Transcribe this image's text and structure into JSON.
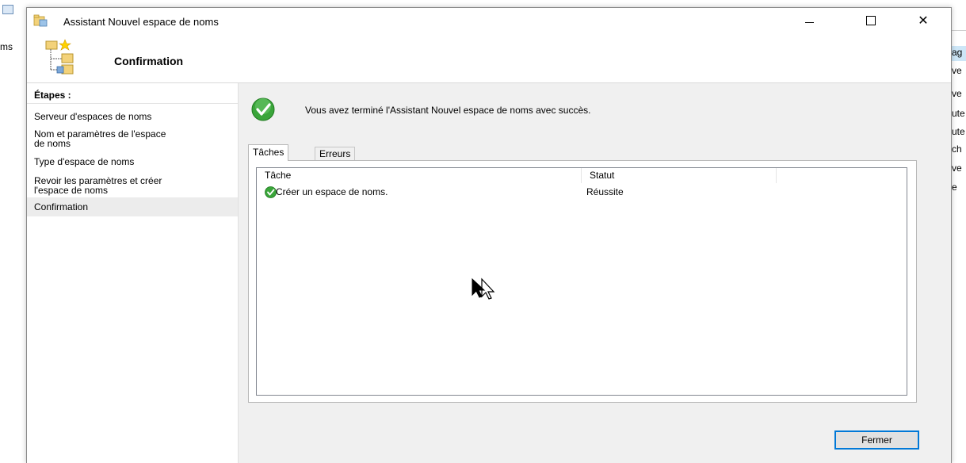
{
  "background_app": {
    "left_fragment": "ms",
    "right_fragments": [
      "ag",
      "ve",
      "ve",
      "ute",
      "ute",
      "ch",
      "ve",
      "e"
    ]
  },
  "window": {
    "title": "Assistant Nouvel espace de noms",
    "icon": "namespace-wizard-icon",
    "controls": {
      "minimize": "minimize-icon",
      "maximize": "maximize-icon",
      "close_glyph": "✕"
    }
  },
  "header": {
    "title": "Confirmation",
    "icon": "namespace-tree-icon"
  },
  "steps": {
    "heading": "Étapes :",
    "items": [
      {
        "label": "Serveur d'espaces de noms"
      },
      {
        "label": "Nom et paramètres de l'espace de noms",
        "line1": "Nom et paramètres de l'espace",
        "line2": "de noms"
      },
      {
        "label": "Type d'espace de noms"
      },
      {
        "label": "Revoir les paramètres et créer l'espace de noms",
        "line1": "Revoir les paramètres et créer",
        "line2": "l'espace de noms"
      },
      {
        "label": "Confirmation",
        "selected": true
      }
    ]
  },
  "main": {
    "success_message": "Vous avez terminé l'Assistant Nouvel espace de noms avec succès.",
    "success_icon": "success-check-icon",
    "tabs": [
      {
        "label": "Tâches",
        "active": true
      },
      {
        "label": "Erreurs",
        "active": false
      }
    ],
    "table": {
      "columns": [
        "Tâche",
        "Statut"
      ],
      "rows": [
        {
          "task": "Créer un espace de noms.",
          "status": "Réussite",
          "icon": "success-check-icon"
        }
      ]
    },
    "close_button": "Fermer"
  },
  "colors": {
    "accent": "#0078d7",
    "success_green": "#3aa53a",
    "selected_step_bg": "#ececec",
    "content_bg": "#f0f0f0"
  }
}
